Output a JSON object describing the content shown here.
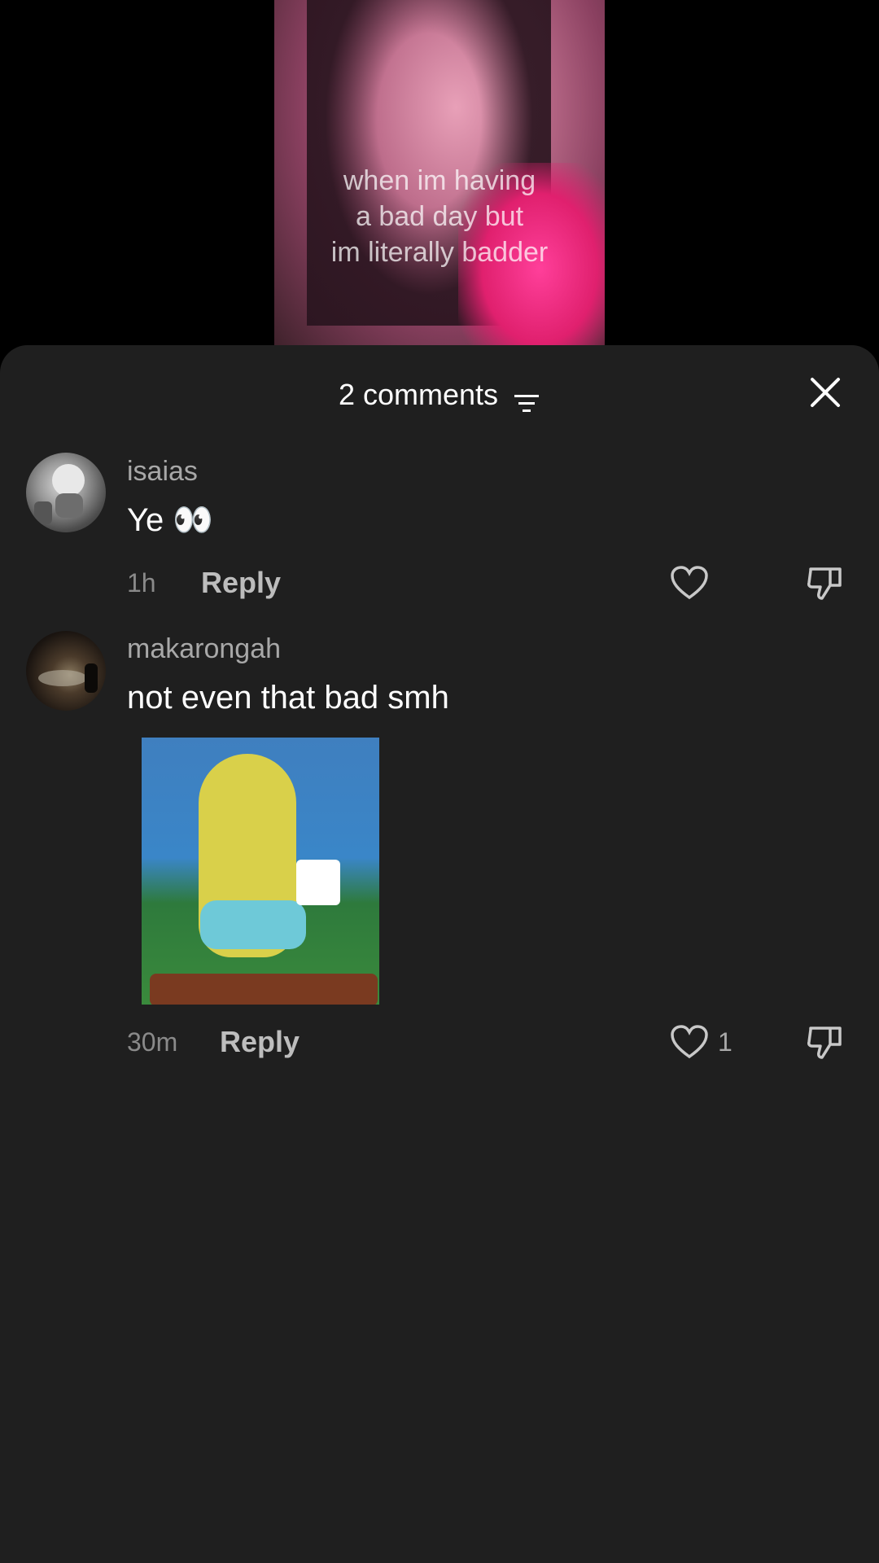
{
  "video": {
    "caption_lines": [
      "when im having",
      "a bad day but",
      "im literally badder"
    ]
  },
  "sheet": {
    "title": "2 comments"
  },
  "comments": [
    {
      "username": "isaias",
      "text": "Ye 👀",
      "time": "1h",
      "reply_label": "Reply",
      "likes": ""
    },
    {
      "username": "makarongah",
      "text": "not even that bad smh",
      "time": "30m",
      "reply_label": "Reply",
      "likes": "1"
    }
  ],
  "icons": {
    "sort": "sort-icon",
    "close": "close-icon",
    "like": "heart-icon",
    "dislike": "thumbs-down-icon"
  },
  "colors": {
    "sheet_bg": "#1f1f1f",
    "secondary_text": "#a8a8a8"
  }
}
